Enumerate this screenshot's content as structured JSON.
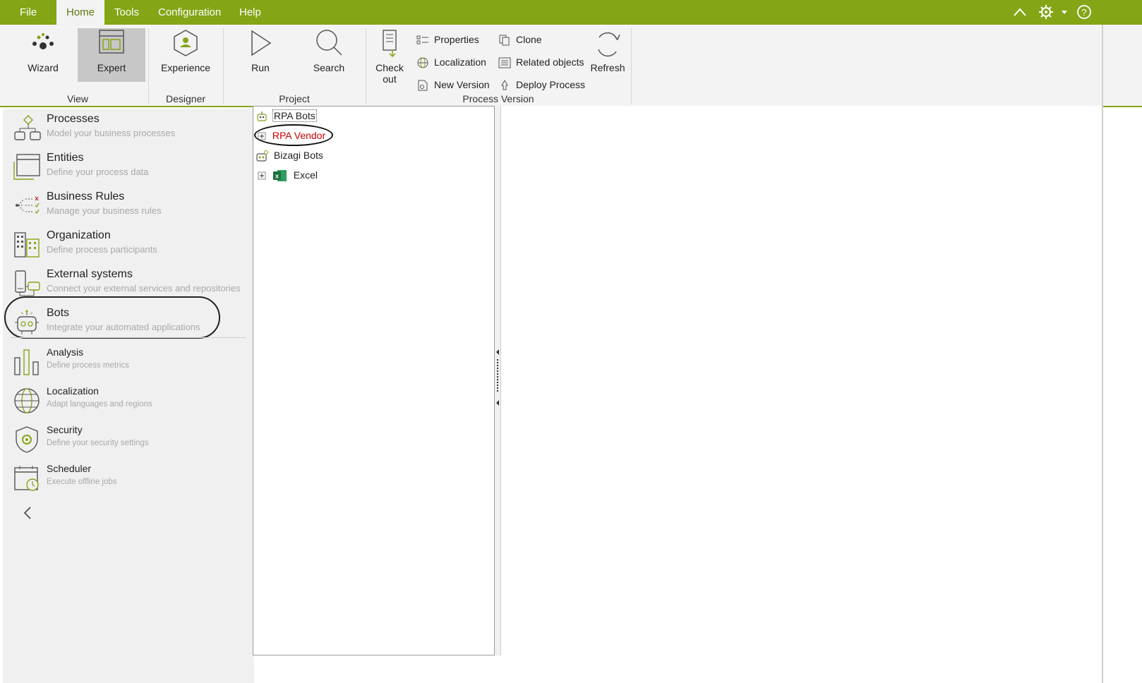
{
  "menu": {
    "items": [
      "File",
      "Home",
      "Tools",
      "Configuration",
      "Help"
    ],
    "active": "Home"
  },
  "ribbon": {
    "view": {
      "label": "View",
      "wizard": "Wizard",
      "expert": "Expert"
    },
    "designer": {
      "label": "Designer",
      "experience": "Experience"
    },
    "project": {
      "label": "Project",
      "run": "Run",
      "search": "Search"
    },
    "process_version": {
      "label": "Process Version",
      "check_out_line1": "Check",
      "check_out_line2": "out",
      "properties": "Properties",
      "localization": "Localization",
      "new_version": "New Version",
      "clone": "Clone",
      "related_objects": "Related objects",
      "deploy_process": "Deploy Process",
      "refresh": "Refresh"
    },
    "accent_color": "#84a516",
    "selected_button": "Expert"
  },
  "nav": {
    "items": [
      {
        "title": "Processes",
        "desc": "Model your business processes",
        "icon": "processes-icon"
      },
      {
        "title": "Entities",
        "desc": "Define your process data",
        "icon": "entities-icon"
      },
      {
        "title": "Business Rules",
        "desc": "Manage your business rules",
        "icon": "business-rules-icon"
      },
      {
        "title": "Organization",
        "desc": "Define process participants",
        "icon": "organization-icon"
      },
      {
        "title": "External systems",
        "desc": "Connect your external services and repositories",
        "icon": "external-systems-icon"
      },
      {
        "title": "Bots",
        "desc": "Integrate your automated applications",
        "icon": "bots-icon"
      },
      {
        "title": "Analysis",
        "desc": "Define process metrics",
        "icon": "analysis-icon"
      },
      {
        "title": "Localization",
        "desc": "Adapt languages and regions",
        "icon": "localization-icon"
      },
      {
        "title": "Security",
        "desc": "Define your security settings",
        "icon": "security-icon"
      },
      {
        "title": "Scheduler",
        "desc": "Execute offline jobs",
        "icon": "scheduler-icon"
      }
    ],
    "highlighted": "Bots",
    "collapse_glyph": "‹"
  },
  "tree": {
    "nodes": [
      {
        "label": "RPA Bots",
        "level": 0
      },
      {
        "label": "RPA Vendor",
        "level": 1,
        "expandable": true,
        "color": "#cc0000"
      },
      {
        "label": "Bizagi Bots",
        "level": 0
      },
      {
        "label": "Excel",
        "level": 1,
        "expandable": true
      }
    ],
    "highlighted": "RPA Vendor"
  }
}
